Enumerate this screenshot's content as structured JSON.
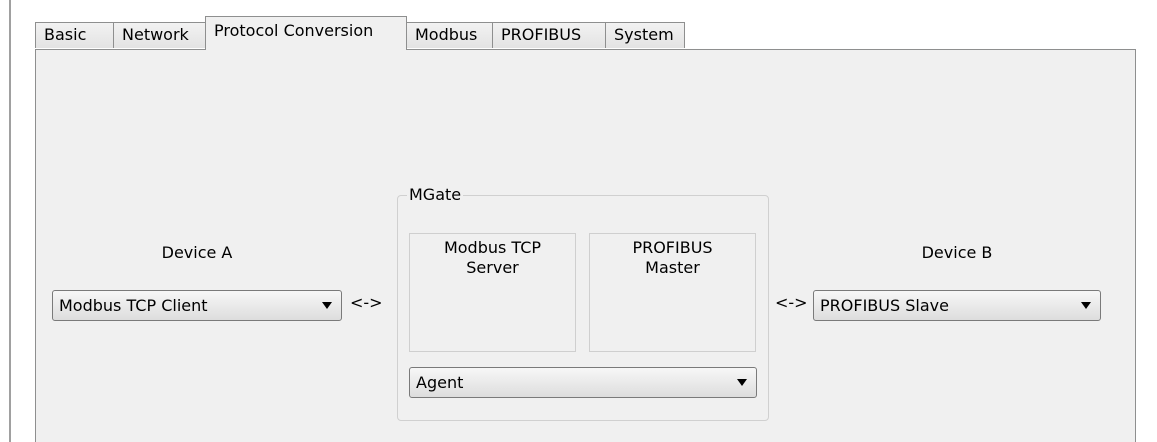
{
  "tabs": [
    {
      "label": "Basic",
      "active": false
    },
    {
      "label": "Network",
      "active": false
    },
    {
      "label": "Protocol Conversion",
      "active": true
    },
    {
      "label": "Modbus",
      "active": false
    },
    {
      "label": "PROFIBUS",
      "active": false
    },
    {
      "label": "System",
      "active": false
    }
  ],
  "device_a": {
    "label": "Device A",
    "selected": "Modbus TCP Client"
  },
  "device_b": {
    "label": "Device B",
    "selected": "PROFIBUS Slave"
  },
  "arrows": {
    "left": "<->",
    "right": "<->"
  },
  "mgate": {
    "title": "MGate",
    "left_box": {
      "line1": "Modbus TCP",
      "line2": "Server"
    },
    "right_box": {
      "line1": "PROFIBUS",
      "line2": "Master"
    },
    "mode_selected": "Agent"
  },
  "icons": {
    "dropdown": "chevron-down-icon"
  }
}
